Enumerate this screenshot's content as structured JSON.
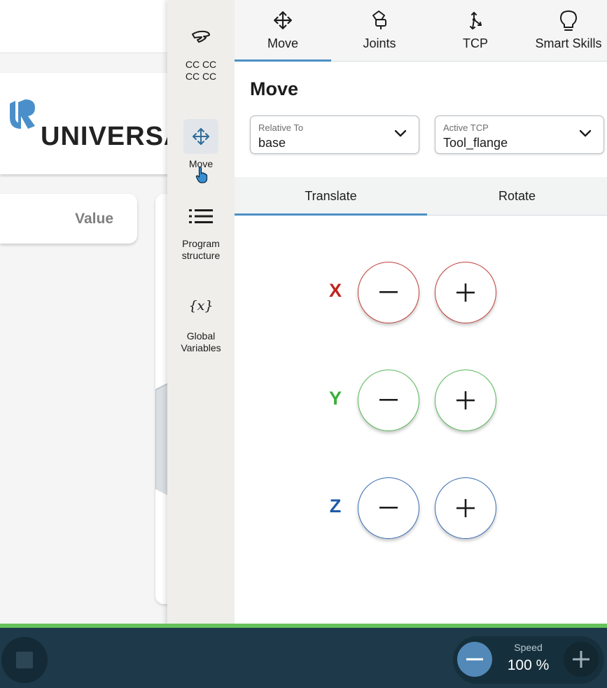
{
  "background": {
    "brand_text": "UNIVERSA",
    "value_header": "Value"
  },
  "nav": {
    "items": [
      {
        "label_line1": "CC CC",
        "label_line2": "CC CC",
        "icon": "tool-hand-icon"
      },
      {
        "label": "Move",
        "icon": "move-arrows-icon",
        "active": true
      },
      {
        "label_line1": "Program",
        "label_line2": "structure",
        "icon": "list-icon"
      },
      {
        "label_line1": "Global",
        "label_line2": "Variables",
        "icon": "variable-icon",
        "icon_text": "{x}"
      }
    ]
  },
  "tabs": [
    {
      "label": "Move",
      "icon": "move-arrows-icon",
      "active": true
    },
    {
      "label": "Joints",
      "icon": "joint-icon"
    },
    {
      "label": "TCP",
      "icon": "tcp-icon"
    },
    {
      "label": "Smart Skills",
      "icon": "lightbulb-icon"
    }
  ],
  "panel": {
    "title": "Move",
    "relative_to": {
      "label": "Relative To",
      "value": "base"
    },
    "active_tcp": {
      "label": "Active TCP",
      "value": "Tool_flange"
    },
    "modes": [
      {
        "label": "Translate",
        "active": true
      },
      {
        "label": "Rotate"
      }
    ],
    "axes": [
      {
        "label": "X",
        "color": "#c0241c"
      },
      {
        "label": "Y",
        "color": "#3ab03c"
      },
      {
        "label": "Z",
        "color": "#1c5ba8"
      }
    ]
  },
  "bottom_bar": {
    "speed_label": "Speed",
    "speed_value": "100 %",
    "accent_color": "#66c35c"
  }
}
